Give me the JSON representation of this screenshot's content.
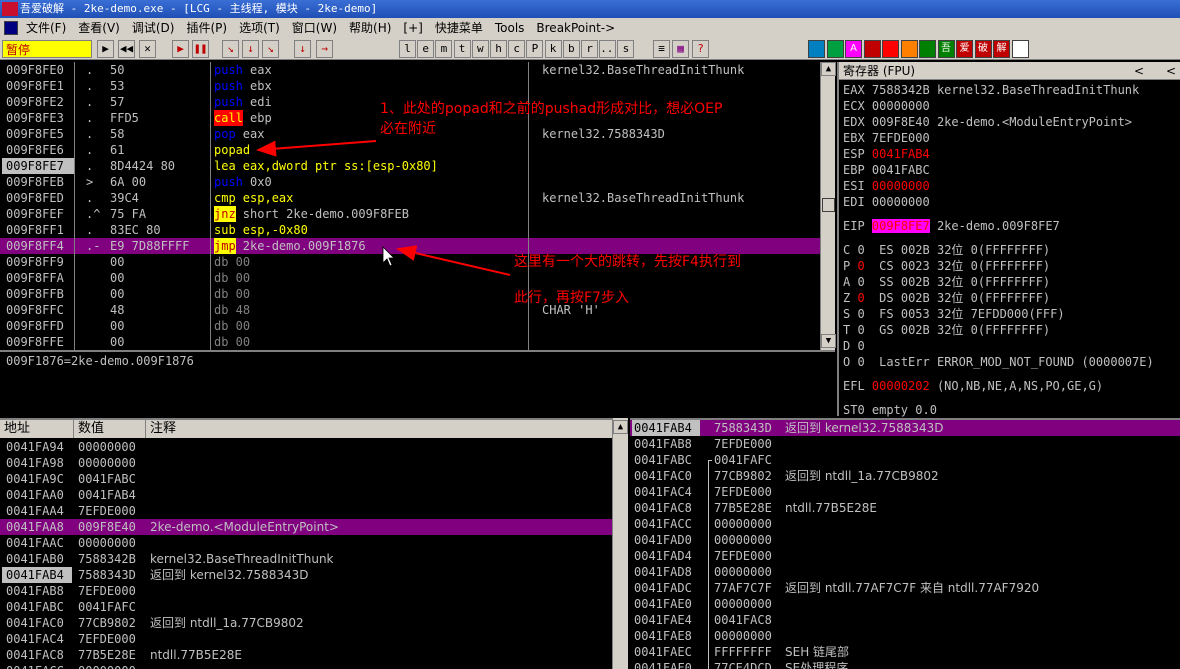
{
  "titlebar": {
    "logo_text": "吾爱破解",
    "title": "吾爱破解 - 2ke-demo.exe - [LCG -  主线程, 模块 - 2ke-demo]"
  },
  "menubar": {
    "items": [
      "文件(F)",
      "查看(V)",
      "调试(D)",
      "插件(P)",
      "选项(T)",
      "窗口(W)",
      "帮助(H)",
      "[+]",
      "快捷菜单",
      "Tools",
      "BreakPoint->"
    ]
  },
  "toolbar": {
    "status": "暂停",
    "left_buttons": [
      "▶",
      "◀◀",
      "✕",
      "▶",
      "❚❚",
      "↘",
      "↓",
      "↘",
      "↓",
      "→"
    ],
    "letter_buttons": [
      "l",
      "e",
      "m",
      "t",
      "w",
      "h",
      "c",
      "P",
      "k",
      "b",
      "r",
      "...",
      "s"
    ],
    "right_icon_labels": [
      "",
      "",
      "A",
      "",
      "",
      "",
      "",
      "吾",
      "爱",
      "破",
      "解",
      ""
    ]
  },
  "cpu": {
    "rows": [
      {
        "addr": "009F8FE0",
        "mark": ".",
        "hex": "50",
        "mnem": "push",
        "ops": "eax",
        "mclass": "mn-push",
        "comment": "kernel32.BaseThreadInitThunk"
      },
      {
        "addr": "009F8FE1",
        "mark": ".",
        "hex": "53",
        "mnem": "push",
        "ops": "ebx",
        "mclass": "mn-push",
        "comment": ""
      },
      {
        "addr": "009F8FE2",
        "mark": ".",
        "hex": "57",
        "mnem": "push",
        "ops": "edi",
        "mclass": "mn-push",
        "comment": ""
      },
      {
        "addr": "009F8FE3",
        "mark": ".",
        "hex": "FFD5",
        "mnem": "call",
        "ops": "ebp",
        "mclass": "mn-call",
        "comment": ""
      },
      {
        "addr": "009F8FE5",
        "mark": ".",
        "hex": "58",
        "mnem": "pop",
        "ops": "eax",
        "mclass": "mn-pop",
        "comment": "kernel32.7588343D"
      },
      {
        "addr": "009F8FE6",
        "mark": ".",
        "hex": "61",
        "mnem": "popad",
        "ops": "",
        "mclass": "mn-popad",
        "comment": ""
      },
      {
        "addr": "009F8FE7",
        "mark": ".",
        "hex": "8D4424 80",
        "mnem": "lea",
        "ops": "eax,dword ptr ss:[esp-0x80]",
        "mclass": "mn-lea",
        "comment": ""
      },
      {
        "addr": "009F8FEB",
        "mark": ">",
        "hex": "6A 00",
        "mnem": "push",
        "ops": "0x0",
        "mclass": "mn-push",
        "comment": ""
      },
      {
        "addr": "009F8FED",
        "mark": ".",
        "hex": "39C4",
        "mnem": "cmp",
        "ops": "esp,eax",
        "mclass": "mn-cmp",
        "comment": "kernel32.BaseThreadInitThunk"
      },
      {
        "addr": "009F8FEF",
        "mark": ".^",
        "hex": "75 FA",
        "mnem": "jnz",
        "ops": "short 2ke-demo.009F8FEB",
        "mclass": "mn-jnz",
        "comment": ""
      },
      {
        "addr": "009F8FF1",
        "mark": ".",
        "hex": "83EC 80",
        "mnem": "sub",
        "ops": "esp,-0x80",
        "mclass": "mn-sub",
        "comment": ""
      },
      {
        "addr": "009F8FF4",
        "mark": ".-",
        "hex": "E9 7D88FFFF",
        "mnem": "jmp",
        "ops": "2ke-demo.009F1876",
        "mclass": "mn-jmp",
        "comment": ""
      },
      {
        "addr": "009F8FF9",
        "mark": "",
        "hex": "00",
        "mnem": "db",
        "ops": "00",
        "mclass": "mn-db",
        "comment": ""
      },
      {
        "addr": "009F8FFA",
        "mark": "",
        "hex": "00",
        "mnem": "db",
        "ops": "00",
        "mclass": "mn-db",
        "comment": ""
      },
      {
        "addr": "009F8FFB",
        "mark": "",
        "hex": "00",
        "mnem": "db",
        "ops": "00",
        "mclass": "mn-db",
        "comment": ""
      },
      {
        "addr": "009F8FFC",
        "mark": "",
        "hex": "48",
        "mnem": "db",
        "ops": "48",
        "mclass": "mn-db",
        "comment": "CHAR 'H'"
      },
      {
        "addr": "009F8FFD",
        "mark": "",
        "hex": "00",
        "mnem": "db",
        "ops": "00",
        "mclass": "mn-db",
        "comment": ""
      },
      {
        "addr": "009F8FFE",
        "mark": "",
        "hex": "00",
        "mnem": "db",
        "ops": "00",
        "mclass": "mn-db",
        "comment": ""
      }
    ]
  },
  "info": {
    "text": "009F1876=2ke-demo.009F1876"
  },
  "registers": {
    "header": "寄存器 (FPU)",
    "header_arrow": "<",
    "header_close": "<",
    "gp": [
      {
        "name": "EAX",
        "value": "7588342B",
        "note": "kernel32.BaseThreadInitThunk",
        "red": false
      },
      {
        "name": "ECX",
        "value": "00000000",
        "note": "",
        "red": false
      },
      {
        "name": "EDX",
        "value": "009F8E40",
        "note": "2ke-demo.<ModuleEntryPoint>",
        "red": false
      },
      {
        "name": "EBX",
        "value": "7EFDE000",
        "note": "",
        "red": false
      },
      {
        "name": "ESP",
        "value": "0041FAB4",
        "note": "",
        "red": true
      },
      {
        "name": "EBP",
        "value": "0041FABC",
        "note": "",
        "red": false
      },
      {
        "name": "ESI",
        "value": "00000000",
        "note": "",
        "red": true
      },
      {
        "name": "EDI",
        "value": "00000000",
        "note": "",
        "red": false
      }
    ],
    "eip": {
      "name": "EIP",
      "value": "009F8FE7",
      "note": "2ke-demo.009F8FE7"
    },
    "flags": [
      {
        "f": "C",
        "v": "0",
        "seg": "ES",
        "sel": "002B",
        "bits": "32位",
        "base": "0(FFFFFFFF)",
        "red": false
      },
      {
        "f": "P",
        "v": "0",
        "seg": "CS",
        "sel": "0023",
        "bits": "32位",
        "base": "0(FFFFFFFF)",
        "red": true
      },
      {
        "f": "A",
        "v": "0",
        "seg": "SS",
        "sel": "002B",
        "bits": "32位",
        "base": "0(FFFFFFFF)",
        "red": false
      },
      {
        "f": "Z",
        "v": "0",
        "seg": "DS",
        "sel": "002B",
        "bits": "32位",
        "base": "0(FFFFFFFF)",
        "red": true
      },
      {
        "f": "S",
        "v": "0",
        "seg": "FS",
        "sel": "0053",
        "bits": "32位",
        "base": "7EFDD000(FFF)",
        "red": false
      },
      {
        "f": "T",
        "v": "0",
        "seg": "GS",
        "sel": "002B",
        "bits": "32位",
        "base": "0(FFFFFFFF)",
        "red": false
      },
      {
        "f": "D",
        "v": "0",
        "seg": "",
        "sel": "",
        "bits": "",
        "base": "",
        "red": false
      },
      {
        "f": "O",
        "v": "0",
        "seg": "LastErr",
        "sel": "ERROR_MOD_NOT_FOUND (0000007E)",
        "bits": "",
        "base": "",
        "red": false
      }
    ],
    "efl": {
      "name": "EFL",
      "value": "00000202",
      "note": "(NO,NB,NE,A,NS,PO,GE,G)"
    },
    "st0": "ST0 empty 0.0"
  },
  "dump": {
    "headers": [
      "地址",
      "数值",
      "注释"
    ],
    "rows": [
      {
        "addr": "0041FA94",
        "val": "00000000",
        "note": "",
        "hl": false,
        "sel": false
      },
      {
        "addr": "0041FA98",
        "val": "00000000",
        "note": "",
        "hl": false,
        "sel": false
      },
      {
        "addr": "0041FA9C",
        "val": "0041FABC",
        "note": "",
        "hl": false,
        "sel": false
      },
      {
        "addr": "0041FAA0",
        "val": "0041FAB4",
        "note": "",
        "hl": false,
        "sel": false
      },
      {
        "addr": "0041FAA4",
        "val": "7EFDE000",
        "note": "",
        "hl": false,
        "sel": false
      },
      {
        "addr": "0041FAA8",
        "val": "009F8E40",
        "note": "2ke-demo.<ModuleEntryPoint>",
        "hl": true,
        "sel": false
      },
      {
        "addr": "0041FAAC",
        "val": "00000000",
        "note": "",
        "hl": false,
        "sel": false
      },
      {
        "addr": "0041FAB0",
        "val": "7588342B",
        "note": "kernel32.BaseThreadInitThunk",
        "hl": false,
        "sel": false
      },
      {
        "addr": "0041FAB4",
        "val": "7588343D",
        "note": "返回到 kernel32.7588343D",
        "hl": false,
        "sel": true
      },
      {
        "addr": "0041FAB8",
        "val": "7EFDE000",
        "note": "",
        "hl": false,
        "sel": false
      },
      {
        "addr": "0041FABC",
        "val": "0041FAFC",
        "note": "",
        "hl": false,
        "sel": false
      },
      {
        "addr": "0041FAC0",
        "val": "77CB9802",
        "note": "返回到 ntdll_1a.77CB9802",
        "hl": false,
        "sel": false
      },
      {
        "addr": "0041FAC4",
        "val": "7EFDE000",
        "note": "",
        "hl": false,
        "sel": false
      },
      {
        "addr": "0041FAC8",
        "val": "77B5E28E",
        "note": "ntdll.77B5E28E",
        "hl": false,
        "sel": false
      },
      {
        "addr": "0041FACC",
        "val": "00000000",
        "note": "",
        "hl": false,
        "sel": false
      }
    ]
  },
  "stack": {
    "rows": [
      {
        "addr": "0041FAB4",
        "val": "7588343D",
        "note": "返回到 kernel32.7588343D",
        "hl": true
      },
      {
        "addr": "0041FAB8",
        "val": "7EFDE000",
        "note": "",
        "hl": false
      },
      {
        "addr": "0041FABC",
        "val": "0041FAFC",
        "note": "",
        "hl": false
      },
      {
        "addr": "0041FAC0",
        "val": "77CB9802",
        "note": "返回到 ntdll_1a.77CB9802",
        "hl": false
      },
      {
        "addr": "0041FAC4",
        "val": "7EFDE000",
        "note": "",
        "hl": false
      },
      {
        "addr": "0041FAC8",
        "val": "77B5E28E",
        "note": "ntdll.77B5E28E",
        "hl": false
      },
      {
        "addr": "0041FACC",
        "val": "00000000",
        "note": "",
        "hl": false
      },
      {
        "addr": "0041FAD0",
        "val": "00000000",
        "note": "",
        "hl": false
      },
      {
        "addr": "0041FAD4",
        "val": "7EFDE000",
        "note": "",
        "hl": false
      },
      {
        "addr": "0041FAD8",
        "val": "00000000",
        "note": "",
        "hl": false
      },
      {
        "addr": "0041FADC",
        "val": "77AF7C7F",
        "note": "返回到 ntdll.77AF7C7F 来自 ntdll.77AF7920",
        "hl": false
      },
      {
        "addr": "0041FAE0",
        "val": "00000000",
        "note": "",
        "hl": false
      },
      {
        "addr": "0041FAE4",
        "val": "0041FAC8",
        "note": "",
        "hl": false
      },
      {
        "addr": "0041FAE8",
        "val": "00000000",
        "note": "",
        "hl": false
      },
      {
        "addr": "0041FAEC",
        "val": "FFFFFFFF",
        "note": "SEH 链尾部",
        "hl": false
      },
      {
        "addr": "0041FAF0",
        "val": "77CE4DCD",
        "note": "SE处理程序",
        "hl": false
      }
    ]
  },
  "annotations": {
    "note1_line1": "1、此处的popad和之前的pushad形成对比，想必OEP",
    "note1_line2": "必在附近",
    "note2_line1": "这里有一个大的跳转，先按F4执行到",
    "note2_line2": "此行，再按F7步入"
  },
  "colors": {
    "highlight": "#800080",
    "annotation": "#ff0000",
    "eip_bg": "#ff00ff"
  }
}
